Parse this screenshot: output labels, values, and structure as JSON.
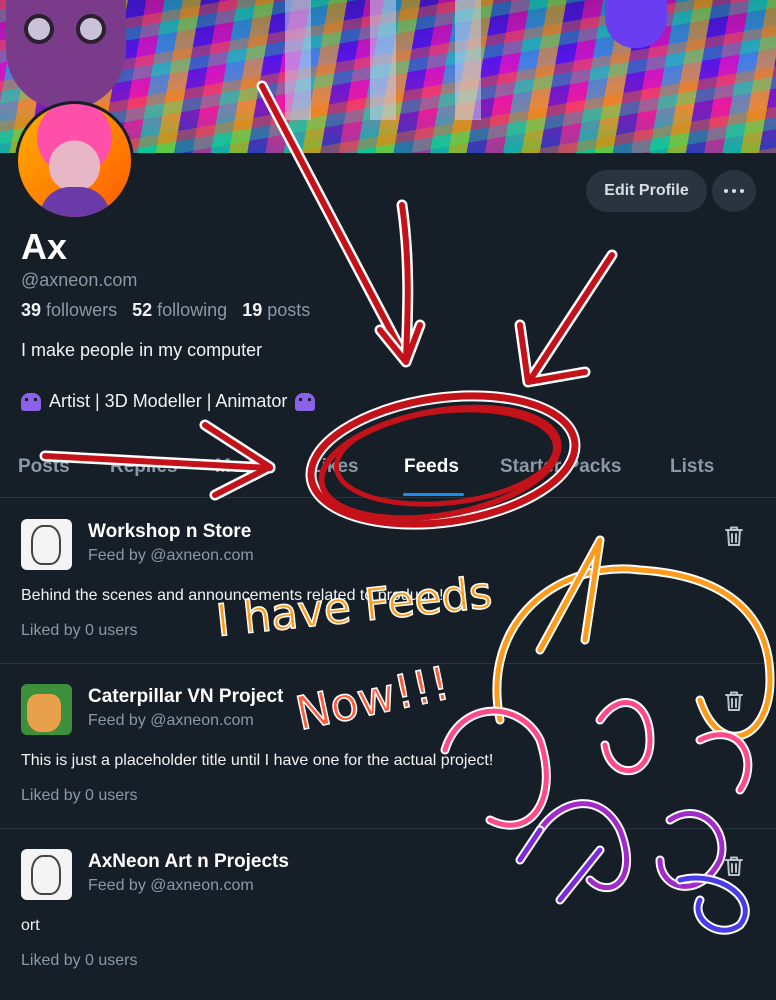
{
  "profile": {
    "name": "Ax",
    "handle": "@axneon.com",
    "followers_count": "39",
    "followers_label": "followers",
    "following_count": "52",
    "following_label": "following",
    "posts_count": "19",
    "posts_label": "posts",
    "bio_line1": "I make people in my computer",
    "bio_line2": "Artist | 3D Modeller | Animator"
  },
  "actions": {
    "edit_profile": "Edit Profile"
  },
  "tabs": [
    {
      "label": "Posts"
    },
    {
      "label": "Replies"
    },
    {
      "label": "Media"
    },
    {
      "label": "Likes"
    },
    {
      "label": "Feeds",
      "active": true
    },
    {
      "label": "Starter Packs"
    },
    {
      "label": "Lists"
    }
  ],
  "feeds": [
    {
      "title": "Workshop n Store",
      "by": "Feed by @axneon.com",
      "description": "Behind the scenes and announcements related to products!",
      "liked": "Liked by 0 users"
    },
    {
      "title": "Caterpillar VN Project",
      "by": "Feed by @axneon.com",
      "description": "This is just a placeholder title until I have one for the actual project!",
      "liked": "Liked by 0 users"
    },
    {
      "title": "AxNeon Art n Projects",
      "by": "Feed by @axneon.com",
      "description": "ort",
      "liked": "Liked by 0 users"
    }
  ],
  "annotation": {
    "line1": "I have Feeds",
    "line2": "Now!!!",
    "colors": {
      "red": "#c4121a",
      "orange": "#ff9b1a",
      "pink": "#ff4a8a",
      "purple": "#7a2ad8"
    }
  },
  "icons": {
    "more": "ellipsis-icon",
    "delete": "trash-icon",
    "emoji": "alien-monster-icon"
  },
  "colors": {
    "background": "#161e27",
    "accent": "#1d8cf0",
    "muted": "#8b98a8"
  }
}
